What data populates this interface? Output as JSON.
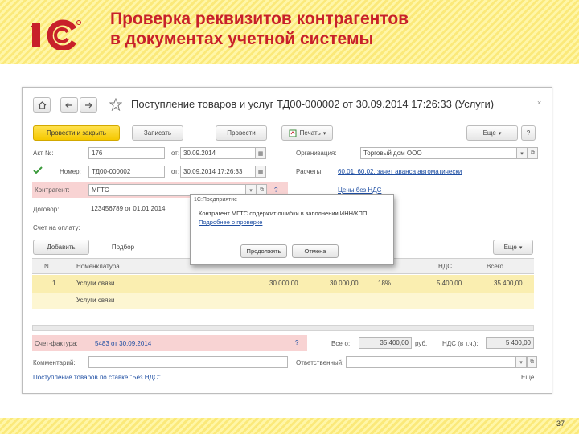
{
  "slide": {
    "title_line1": "Проверка реквизитов контрагентов",
    "title_line2": "в документах учетной системы",
    "page_number": "37",
    "title_color": "#c8202a",
    "accent_color": "#f5c800"
  },
  "document": {
    "title": "Поступление товаров и услуг ТД00-000002 от 30.09.2014 17:26:33 (Услуги)",
    "close_label": "×"
  },
  "toolbar": {
    "post_and_close": "Провести и закрыть",
    "write": "Записать",
    "post": "Провести",
    "print": "Печать",
    "more": "Еще",
    "help": "?"
  },
  "form": {
    "act_no_label": "Акт №:",
    "act_no_value": "176",
    "act_date_label": "от:",
    "act_date_value": "30.09.2014",
    "number_label": "Номер:",
    "number_value": "ТД00-000002",
    "number_date_label": "от:",
    "number_date_value": "30.09.2014 17:26:33",
    "counterparty_label": "Контрагент:",
    "counterparty_value": "МГТС",
    "contract_label": "Договор:",
    "contract_value": "123456789 от 01.01.2014",
    "invoice_payment_label": "Счет на оплату:",
    "organization_label": "Организация:",
    "organization_value": "Торговый дом ООО",
    "calculations_label": "Расчеты:",
    "calculations_link": "60.01, 60.02, зачет аванса автоматически",
    "vat_link": "Цены без НДС",
    "help_mark": "?"
  },
  "table_toolbar": {
    "add": "Добавить",
    "pick": "Подбор",
    "more": "Еще"
  },
  "table": {
    "headers": [
      "N",
      "Номенклатура",
      "НДС",
      "Всего"
    ],
    "rows": [
      {
        "n": "1",
        "item": "Услуги связи",
        "sum1": "30 000,00",
        "sum2": "30 000,00",
        "rate": "18%",
        "vat": "5 400,00",
        "total": "35 400,00"
      },
      {
        "n": "",
        "item": "Услуги связи",
        "sum1": "",
        "sum2": "",
        "rate": "",
        "vat": "",
        "total": ""
      }
    ]
  },
  "dialog": {
    "title": "1С:Предприятие",
    "message": "Контрагент МГТС содержит ошибки в заполнении ИНН/КПП",
    "link": "Подробнее о проверке",
    "continue_btn": "Продолжить",
    "cancel_btn": "Отмена"
  },
  "bottom": {
    "invoice_label": "Счет-фактура:",
    "invoice_link": "5483 от 30.09.2014",
    "comment_label": "Комментарий:",
    "responsible_label": "Ответственный:",
    "total_label": "Всего:",
    "total_value": "35 400,00",
    "currency": "руб.",
    "vat_incl_label": "НДС (в т.ч.):",
    "vat_incl_value": "5 400,00",
    "footer_note": "Поступление товаров по ставке \"Без НДС\"",
    "more": "Еще"
  }
}
